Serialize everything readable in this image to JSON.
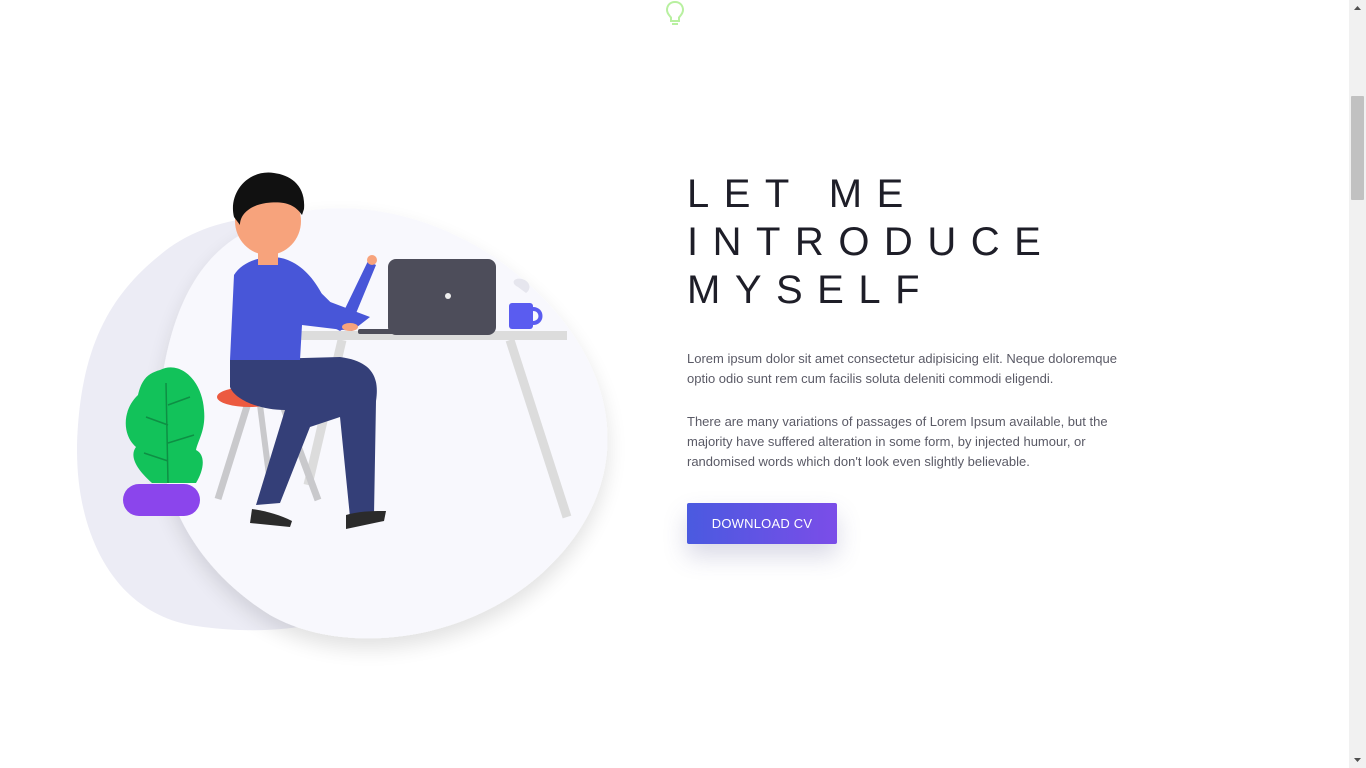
{
  "section": {
    "heading_lines": [
      "LET ME",
      "INTRODUCE",
      "MYSELF"
    ],
    "paragraph_1": "Lorem ipsum dolor sit amet consectetur adipisicing elit. Neque doloremque optio odio sunt rem cum facilis soluta deleniti commodi eligendi.",
    "paragraph_2": "There are many variations of passages of Lorem Ipsum available, but the majority have suffered alteration in some form, by injected humour, or randomised words which don't look even slightly believable.",
    "button_label": "DOWNLOAD CV"
  },
  "icons": {
    "top": "lightbulb-icon"
  },
  "colors": {
    "heading": "#1e1e28",
    "body_text": "#5a5a66",
    "button_gradient_start": "#4a5ae0",
    "button_gradient_end": "#7b4de8",
    "bulb": "#b8f0a0"
  }
}
